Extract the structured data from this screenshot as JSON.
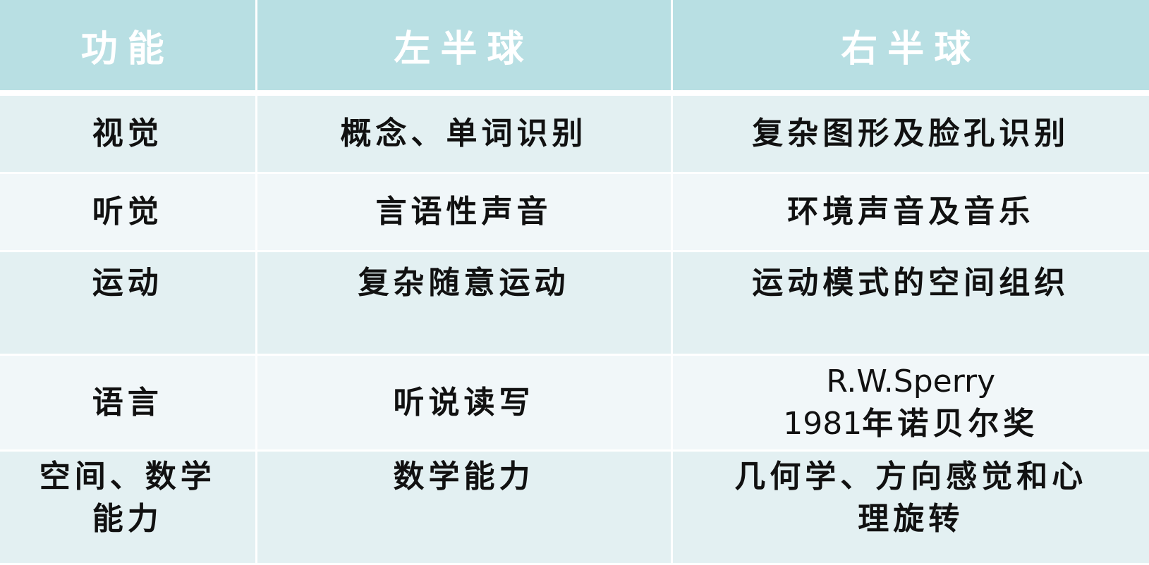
{
  "header": {
    "col1": "功能",
    "col2": "左半球",
    "col3": "右半球"
  },
  "rows": [
    {
      "function": "视觉",
      "left": "概念、单词识别",
      "right": "复杂图形及脸孔识别"
    },
    {
      "function": "听觉",
      "left": "言语性声音",
      "right": "环境声音及音乐"
    },
    {
      "function": "运动",
      "left": "复杂随意运动",
      "right": "运动模式的空间组织"
    },
    {
      "function": "语言",
      "left": "听说读写",
      "right_line1": "R.W.Sperry",
      "right_line2_num": "1981",
      "right_line2_text": "年诺贝尔奖"
    },
    {
      "function_line1": "空间、数学",
      "function_line2": "能力",
      "left": "数学能力",
      "right_line1": "几何学、方向感觉和心",
      "right_line2": "理旋转"
    }
  ],
  "colors": {
    "header_bg": "#b8dfe3",
    "row_odd_bg": "#e3f0f2",
    "row_even_bg": "#f1f7f9",
    "header_text": "#ffffff",
    "body_text": "#111111"
  }
}
